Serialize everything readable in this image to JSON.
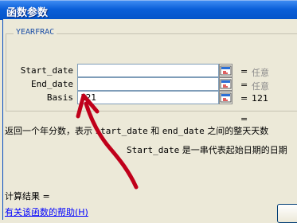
{
  "window": {
    "title": "函数参数"
  },
  "function_group": {
    "name": "YEARFRAC"
  },
  "arguments": [
    {
      "label": "Start_date",
      "value": "",
      "equals": "=",
      "result": "任意",
      "result_muted": true
    },
    {
      "label": "End_date",
      "value": "",
      "equals": "=",
      "result": "任意",
      "result_muted": true
    },
    {
      "label": "Basis",
      "value": "121",
      "equals": "=",
      "result": "121",
      "result_muted": false
    }
  ],
  "formula_result_equals": "=",
  "description": {
    "prefix": "返回一个年分数，表示 ",
    "start_token": "start_date",
    "middle": " 和 ",
    "end_token": "end_date",
    "suffix": " 之间的整天天数"
  },
  "argument_help": {
    "name": "Start_date",
    "text": "  是一串代表起始日期的日期"
  },
  "calc_result_label": "计算结果 =",
  "help_link": "有关该函数的帮助(H)",
  "icons": {
    "collapse": "collapse-dialog-icon",
    "annotation": "red-arrow-annotation"
  },
  "colors": {
    "titlebar": "#0a5fd8",
    "annotation": "#c0001a",
    "link": "#0000ff"
  }
}
